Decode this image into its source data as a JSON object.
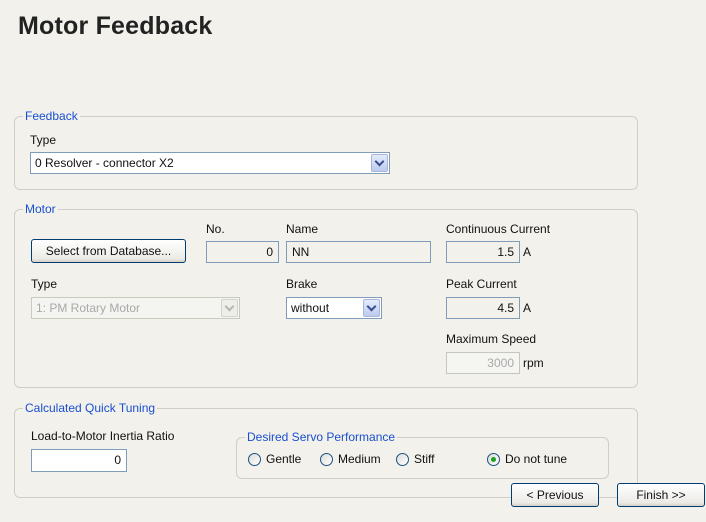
{
  "title": "Motor Feedback",
  "feedback": {
    "legend": "Feedback",
    "type_label": "Type",
    "type_value": "0 Resolver - connector X2"
  },
  "motor": {
    "legend": "Motor",
    "select_db_button": "Select from Database...",
    "no_label": "No.",
    "no_value": "0",
    "name_label": "Name",
    "name_value": "NN",
    "cont_current_label": "Continuous Current",
    "cont_current_value": "1.5",
    "cont_current_unit": "A",
    "type_label": "Type",
    "type_value": "1: PM Rotary Motor",
    "brake_label": "Brake",
    "brake_value": "without",
    "peak_current_label": "Peak Current",
    "peak_current_value": "4.5",
    "peak_current_unit": "A",
    "max_speed_label": "Maximum Speed",
    "max_speed_value": "3000",
    "max_speed_unit": "rpm"
  },
  "tuning": {
    "legend": "Calculated Quick Tuning",
    "inertia_label": "Load-to-Motor Inertia Ratio",
    "inertia_value": "0",
    "performance_legend": "Desired Servo Performance",
    "options": [
      {
        "label": "Gentle",
        "selected": false
      },
      {
        "label": "Medium",
        "selected": false
      },
      {
        "label": "Stiff",
        "selected": false
      },
      {
        "label": "Do not tune",
        "selected": true
      }
    ]
  },
  "nav": {
    "previous": "< Previous",
    "finish": "Finish >>"
  }
}
